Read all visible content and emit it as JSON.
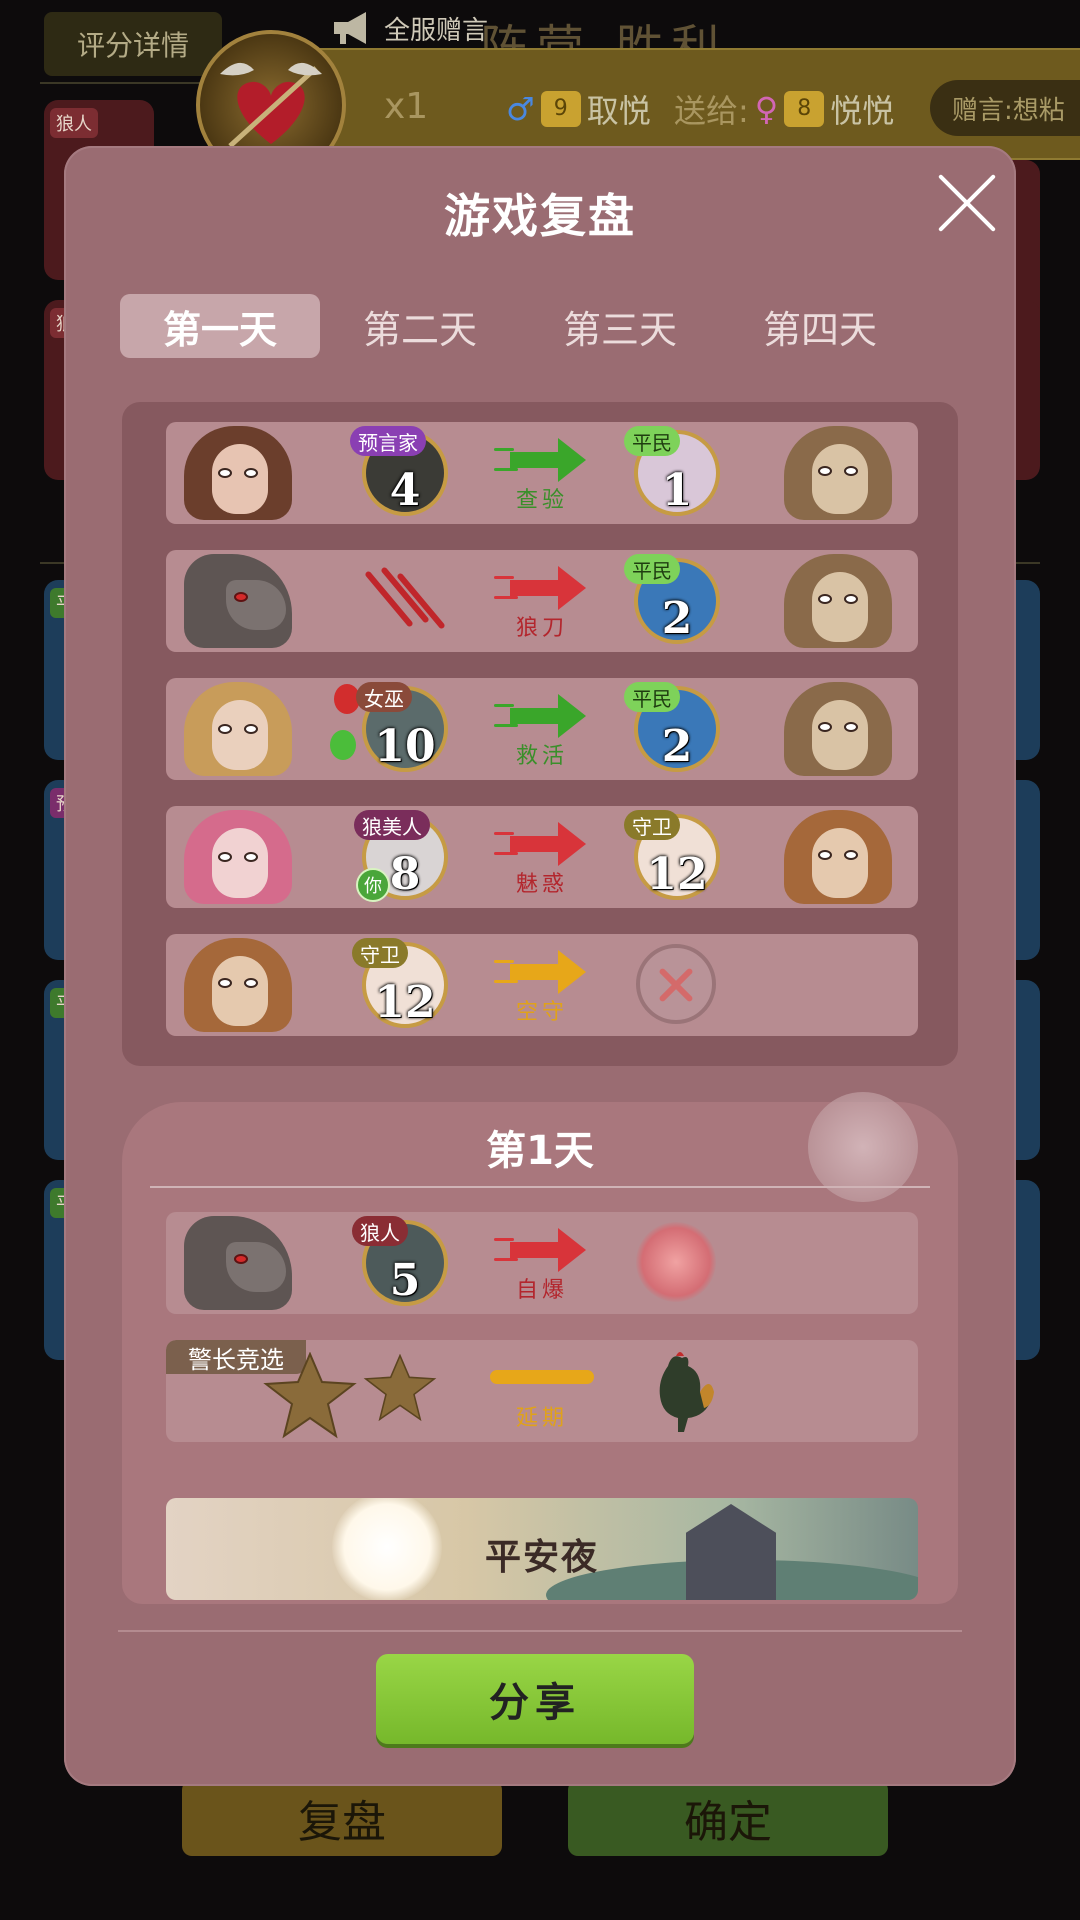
{
  "background": {
    "score_details_label": "评分详情",
    "server_notice": "全服赠言",
    "result_text": "阵营 胜利",
    "gift": {
      "multiplier": "x1",
      "sender_level": "9",
      "sender_name": "取悦",
      "send_to_label": "送给:",
      "receiver_level": "8",
      "receiver_name": "悦悦",
      "message": "赠言:想粘"
    },
    "card_tags": [
      "狼人",
      "狼",
      "预",
      "平",
      "平",
      "平",
      "平"
    ],
    "bottom_buttons": {
      "replay": "复盘",
      "confirm": "确定"
    }
  },
  "modal": {
    "title": "游戏复盘",
    "tabs": [
      {
        "label": "第一天",
        "active": true
      },
      {
        "label": "第二天",
        "active": false
      },
      {
        "label": "第三天",
        "active": false
      },
      {
        "label": "第四天",
        "active": false
      }
    ],
    "night_actions": [
      {
        "actor_role": "预言家",
        "actor_number": "4",
        "action": "查验",
        "arrow_color": "green",
        "target_role": "平民",
        "target_number": "1"
      },
      {
        "actor_role": "",
        "actor_number": "",
        "action": "狼刀",
        "arrow_color": "red",
        "target_role": "平民",
        "target_number": "2"
      },
      {
        "actor_role": "女巫",
        "actor_number": "10",
        "action": "救活",
        "arrow_color": "green",
        "target_role": "平民",
        "target_number": "2"
      },
      {
        "actor_role": "狼美人",
        "actor_number": "8",
        "you_label": "你",
        "action": "魅惑",
        "arrow_color": "red",
        "target_role": "守卫",
        "target_number": "12"
      },
      {
        "actor_role": "守卫",
        "actor_number": "12",
        "action": "空守",
        "arrow_color": "yellow",
        "target_role": "",
        "target_number": ""
      }
    ],
    "day_section": {
      "title": "第1天",
      "events": [
        {
          "actor_role": "狼人",
          "actor_number": "5",
          "action": "自爆",
          "arrow_color": "red"
        },
        {
          "banner": "警长竞选",
          "action": "延期",
          "arrow_color": "yellow"
        }
      ],
      "safe_night_label": "平安夜"
    },
    "share_button_label": "分享"
  },
  "colors": {
    "modal_bg": "#9a6c72",
    "panel_bg": "#86595f",
    "row_bg": "#b78c91",
    "arrow_green": "#3aa62a",
    "arrow_red": "#d8343a",
    "arrow_yellow": "#e7a719",
    "share_green": "#86c634"
  }
}
